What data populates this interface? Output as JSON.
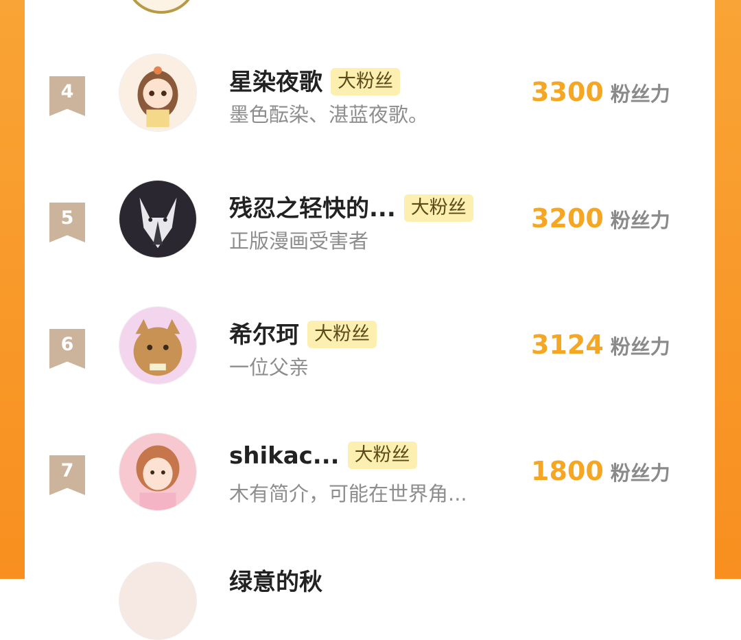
{
  "badge_label": "大粉丝",
  "score_unit": "粉丝力",
  "rows": [
    {
      "rank": "4",
      "name": "星染夜歌",
      "desc": "墨色酝染、湛蓝夜歌。",
      "score": "3300"
    },
    {
      "rank": "5",
      "name": "残忍之轻快的...",
      "desc": "正版漫画受害者",
      "score": "3200"
    },
    {
      "rank": "6",
      "name": "希尔珂",
      "desc": "一位父亲",
      "score": "3124"
    },
    {
      "rank": "7",
      "name": "shikac...",
      "desc": "木有简介，可能在世界角...",
      "score": "1800"
    }
  ],
  "partial_next": {
    "name": "绿意的秋"
  },
  "colors": {
    "accent_orange": "#f5a623",
    "side_orange": "#f8921f",
    "badge_bg": "#fcefb0",
    "rank_tag": "#cbb39c"
  }
}
